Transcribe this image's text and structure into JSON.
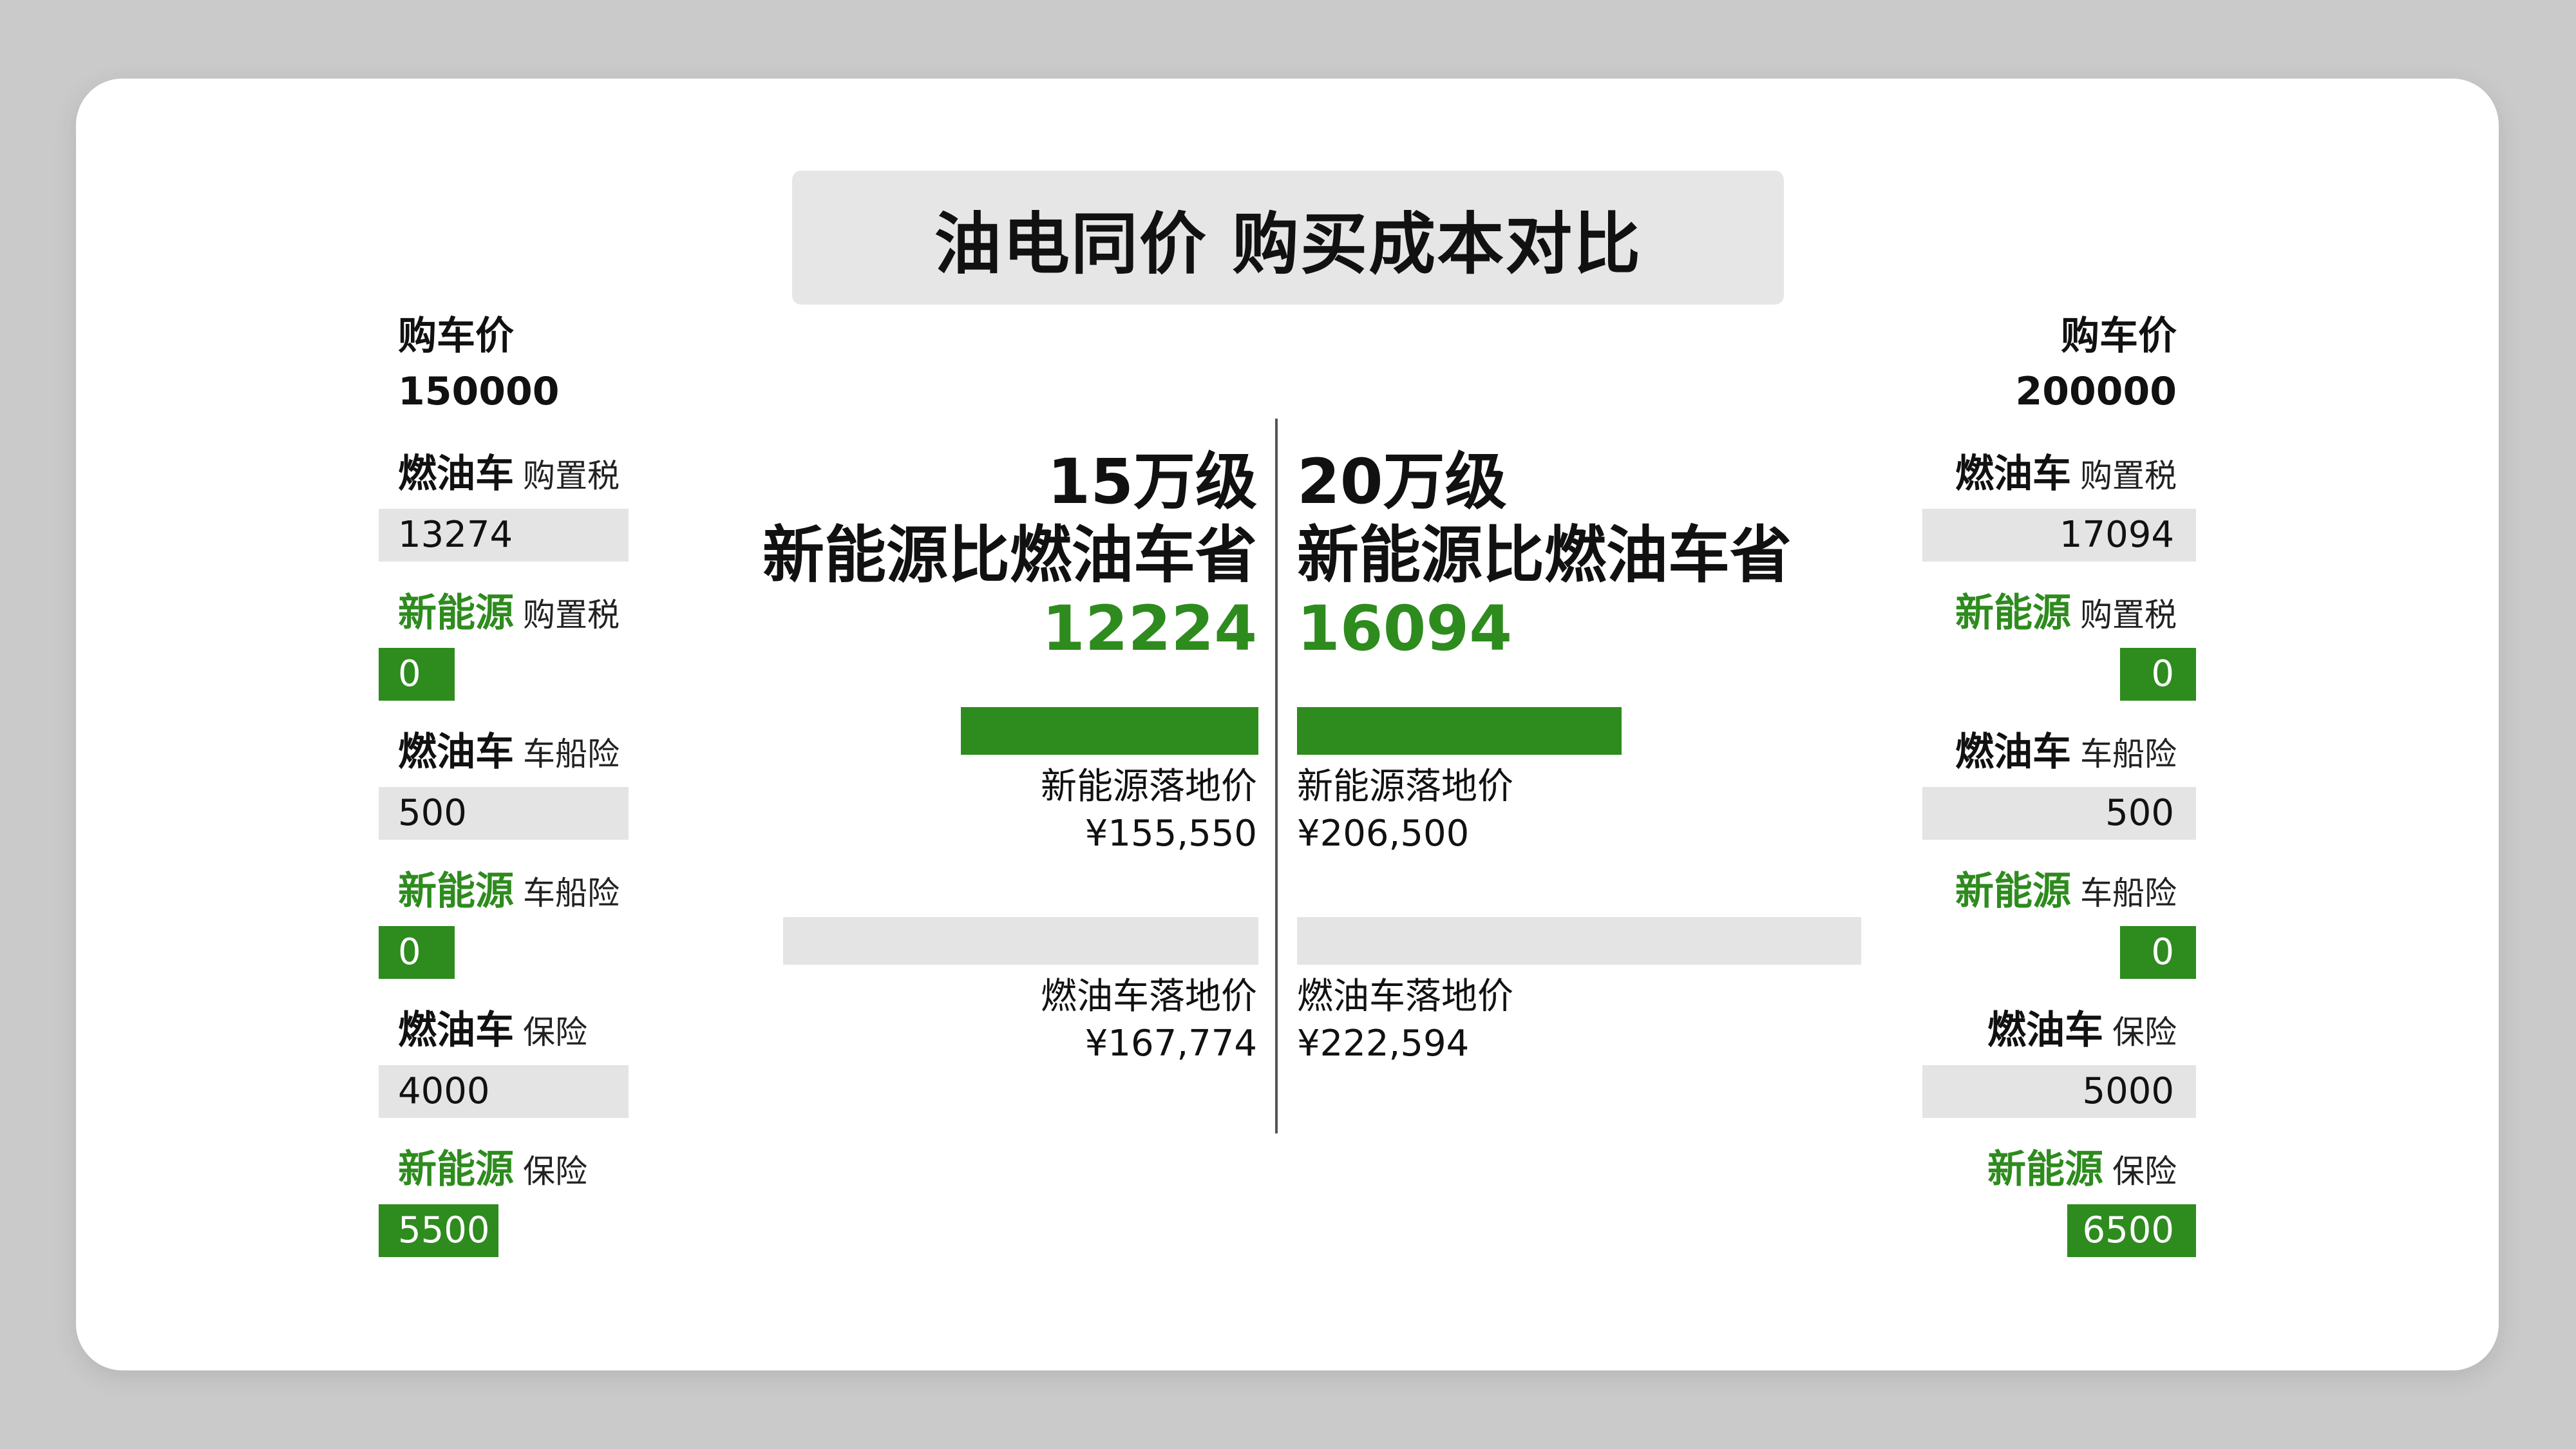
{
  "title": "油电同价 购买成本对比",
  "colors": {
    "accent_green": "#2e8b1e",
    "field_gray": "#e4e4e4",
    "title_gray": "#e6e6e6",
    "background": "#cacaca"
  },
  "left_panel": {
    "price_label": "购车价",
    "price_value": "150000",
    "rows": [
      {
        "kind": "燃油车",
        "item": "购置税",
        "value": "13274"
      },
      {
        "kind": "新能源",
        "item": "购置税",
        "value": "0"
      },
      {
        "kind": "燃油车",
        "item": "车船险",
        "value": "500"
      },
      {
        "kind": "新能源",
        "item": "车船险",
        "value": "0"
      },
      {
        "kind": "燃油车",
        "item": "保险",
        "value": "4000"
      },
      {
        "kind": "新能源",
        "item": "保险",
        "value": "5500"
      }
    ]
  },
  "right_panel": {
    "price_label": "购车价",
    "price_value": "200000",
    "rows": [
      {
        "kind": "燃油车",
        "item": "购置税",
        "value": "17094"
      },
      {
        "kind": "新能源",
        "item": "购置税",
        "value": "0"
      },
      {
        "kind": "燃油车",
        "item": "车船险",
        "value": "500"
      },
      {
        "kind": "新能源",
        "item": "车船险",
        "value": "0"
      },
      {
        "kind": "燃油车",
        "item": "保险",
        "value": "5000"
      },
      {
        "kind": "新能源",
        "item": "保险",
        "value": "6500"
      }
    ]
  },
  "comparison": {
    "left": {
      "tier": "15万级",
      "subtitle": "新能源比燃油车省",
      "saving": "12224",
      "ev_label": "新能源落地价",
      "ev_price": "¥155,550",
      "ice_label": "燃油车落地价",
      "ice_price": "¥167,774"
    },
    "right": {
      "tier": "20万级",
      "subtitle": "新能源比燃油车省",
      "saving": "16094",
      "ev_label": "新能源落地价",
      "ev_price": "¥206,500",
      "ice_label": "燃油车落地价",
      "ice_price": "¥222,594"
    }
  }
}
